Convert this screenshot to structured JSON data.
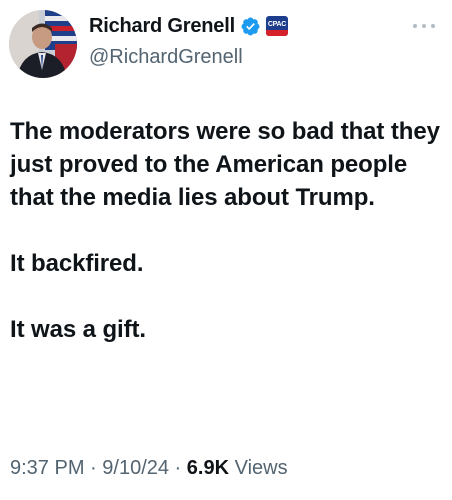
{
  "author": {
    "display_name": "Richard Grenell",
    "handle": "@RichardGrenell",
    "verified_icon": "verified-checkmark-icon",
    "affiliate_badge_text": "CPAC",
    "avatar_icon": "profile-photo"
  },
  "tweet": {
    "text": "The moderators were so bad that they just proved to the American people that the media lies about Trump.\n\nIt backfired.\n\nIt was a gift."
  },
  "meta": {
    "time": "9:37 PM",
    "separator": " · ",
    "date": "9/10/24",
    "views_count": "6.9K",
    "views_label": " Views"
  },
  "colors": {
    "text_primary": "#0f1419",
    "text_secondary": "#536471",
    "verified_blue": "#1d9bf0",
    "more_dots": "#b4bcc2"
  }
}
